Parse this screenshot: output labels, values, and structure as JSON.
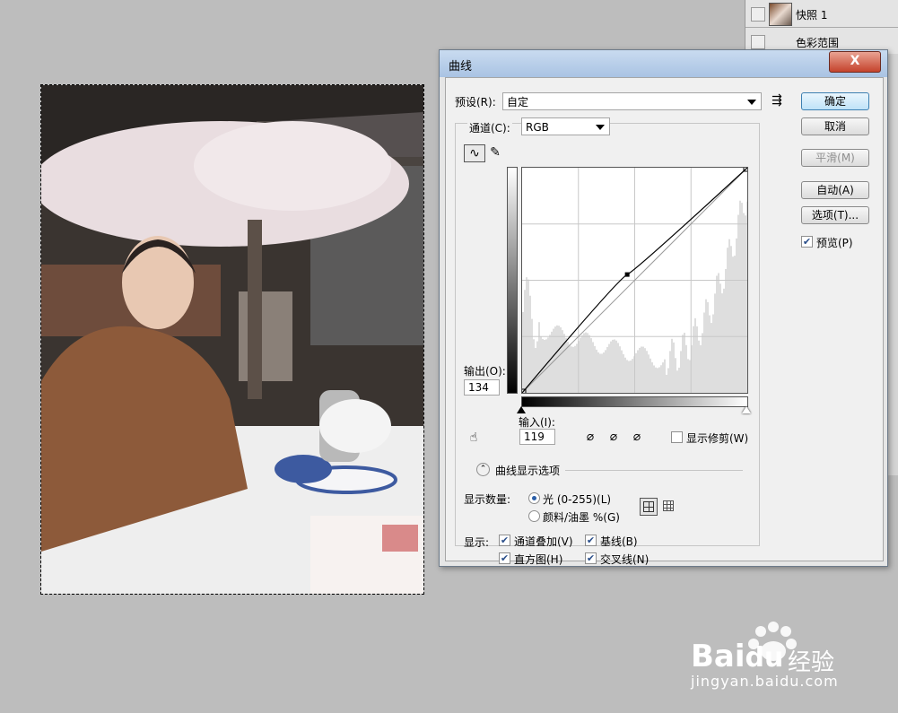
{
  "layers": [
    {
      "name": "快照 1"
    },
    {
      "name": "色彩范围"
    }
  ],
  "dialog": {
    "title": "曲线",
    "close_glyph": "X",
    "preset_label": "预设(R):",
    "preset_value": "自定",
    "preset_menu_icon": "preset-options-icon",
    "channel_label": "通道(C):",
    "channel_value": "RGB",
    "output_label": "输出(O):",
    "output_value": "134",
    "input_label": "输入(I):",
    "input_value": "119",
    "show_clipping_label": "显示修剪(W)",
    "curve_options_label": "曲线显示选项",
    "show_amount_label": "显示数量:",
    "radio_light": "光 (0-255)(L)",
    "radio_pigment": "颜料/油墨 %(G)",
    "show_label": "显示:",
    "check_channel_overlay": "通道叠加(V)",
    "check_baseline": "基线(B)",
    "check_histogram": "直方图(H)",
    "check_intersection": "交叉线(N)",
    "buttons": {
      "ok": "确定",
      "cancel": "取消",
      "smooth": "平滑(M)",
      "auto": "自动(A)",
      "options": "选项(T)..."
    },
    "preview_label": "预览(P)"
  },
  "watermark": {
    "brand": "Bai",
    "brand2": "du",
    "brand_cn": "经验",
    "url": "jingyan.baidu.com"
  },
  "curve": {
    "point": {
      "input": 119,
      "output": 134
    },
    "endpoints": [
      [
        0,
        0
      ],
      [
        255,
        255
      ]
    ]
  }
}
